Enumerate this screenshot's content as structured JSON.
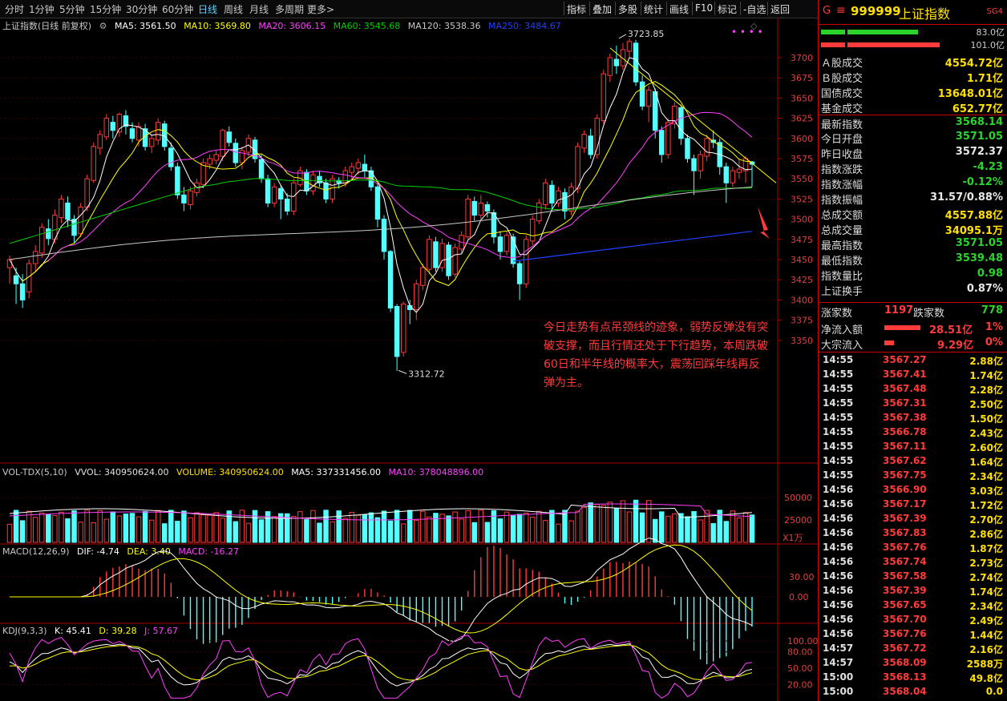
{
  "toolbar": {
    "periods": [
      "分时",
      "1分钟",
      "5分钟",
      "15分钟",
      "30分钟",
      "60分钟",
      "日线",
      "周线",
      "月线",
      "多周期",
      "更多>"
    ],
    "active_period": "日线",
    "buttons": [
      "指标",
      "叠加",
      "多股",
      "统计",
      "画线",
      "F10",
      "标记",
      "-自选",
      "返回"
    ]
  },
  "main_legend": {
    "title": "上证指数(日线 前复权)",
    "ma5": "MA5: 3561.50",
    "ma10": "MA10: 3569.80",
    "ma20": "MA20: 3606.15",
    "ma60": "MA60: 3545.68",
    "ma120": "MA120: 3538.36",
    "ma250": "MA250: 3484.67"
  },
  "high_label": "3723.85",
  "low_label": "3312.72",
  "price_axis": [
    "3700",
    "3675",
    "3650",
    "3625",
    "3600",
    "3575",
    "3550",
    "3525",
    "3500",
    "3475",
    "3450",
    "3425",
    "3400",
    "3375",
    "3350"
  ],
  "vol_legend": {
    "title": "VOL-TDX(5,10)",
    "vvol": "VVOL: 340950624.00",
    "volume": "VOLUME: 340950624.00",
    "ma5": "MA5: 337331456.00",
    "ma10": "MA10: 378048896.00"
  },
  "vol_axis": [
    "50000",
    "25000"
  ],
  "vol_unit": "X1万",
  "macd_legend": {
    "title": "MACD(12,26,9)",
    "dif": "DIF: -4.74",
    "dea": "DEA: 3.40",
    "macd": "MACD: -16.27"
  },
  "macd_axis": [
    "30.00",
    "0.00"
  ],
  "kdj_legend": {
    "title": "KDJ(9,3,3)",
    "k": "K: 45.41",
    "d": "D: 39.28",
    "j": "J: 57.67"
  },
  "kdj_axis": [
    "100.00",
    "80.00",
    "50.00",
    "20.00"
  ],
  "annotation": "今日走势有点吊颈线的迹象，弱势反弹没有突破支撑，而且行情还处于下行趋势，本周跌破60日和半年线的概率大，震荡回踩年线再反弹为主。",
  "quote": {
    "g": "G",
    "menu_icon": "≡",
    "code": "999999",
    "name": "上证指数",
    "badge": "SG4",
    "bar1": "83.0亿",
    "bar2": "101.0亿",
    "rows": [
      {
        "k": "Ａ股成交",
        "v": "4554.72亿",
        "c": "#ffe000"
      },
      {
        "k": "Ｂ股成交",
        "v": "1.71亿",
        "c": "#ffe000"
      },
      {
        "k": "国债成交",
        "v": "13648.01亿",
        "c": "#ffe000"
      },
      {
        "k": "基金成交",
        "v": "652.77亿",
        "c": "#ffe000"
      },
      {
        "k": "最新指数",
        "v": "3568.14",
        "c": "#2bd42b"
      },
      {
        "k": "今日开盘",
        "v": "3571.05",
        "c": "#2bd42b"
      },
      {
        "k": "昨日收盘",
        "v": "3572.37",
        "c": "#e8e8e8"
      },
      {
        "k": "指数涨跌",
        "v": "-4.23",
        "c": "#2bd42b"
      },
      {
        "k": "指数涨幅",
        "v": "-0.12%",
        "c": "#2bd42b"
      },
      {
        "k": "指数振幅",
        "v": "31.57/0.88%",
        "c": "#e8e8e8"
      },
      {
        "k": "总成交额",
        "v": "4557.88亿",
        "c": "#ffe000"
      },
      {
        "k": "总成交量",
        "v": "34095.1万",
        "c": "#ffe000"
      },
      {
        "k": "最高指数",
        "v": "3571.05",
        "c": "#2bd42b"
      },
      {
        "k": "最低指数",
        "v": "3539.48",
        "c": "#2bd42b"
      },
      {
        "k": "指数量比",
        "v": "0.98",
        "c": "#2bd42b"
      },
      {
        "k": "上证换手",
        "v": "0.87%",
        "c": "#e8e8e8"
      }
    ],
    "up_label": "涨家数",
    "up_value": "1197",
    "down_label": "跌家数",
    "down_value": "778",
    "net_label": "净流入额",
    "net_value": "28.51亿",
    "net_pct": "1%",
    "block_label": "大宗流入",
    "block_value": "9.29亿",
    "block_pct": "0%"
  },
  "ticks": [
    {
      "t": "14:55",
      "p": "3567.27",
      "a": "2.88亿"
    },
    {
      "t": "14:55",
      "p": "3567.41",
      "a": "1.74亿"
    },
    {
      "t": "14:55",
      "p": "3567.48",
      "a": "2.28亿"
    },
    {
      "t": "14:55",
      "p": "3567.31",
      "a": "2.50亿"
    },
    {
      "t": "14:55",
      "p": "3567.38",
      "a": "1.50亿"
    },
    {
      "t": "14:55",
      "p": "3566.78",
      "a": "2.43亿"
    },
    {
      "t": "14:55",
      "p": "3567.11",
      "a": "2.60亿"
    },
    {
      "t": "14:55",
      "p": "3567.62",
      "a": "1.64亿"
    },
    {
      "t": "14:55",
      "p": "3567.75",
      "a": "2.34亿"
    },
    {
      "t": "14:56",
      "p": "3566.90",
      "a": "3.03亿"
    },
    {
      "t": "14:56",
      "p": "3567.17",
      "a": "1.72亿"
    },
    {
      "t": "14:56",
      "p": "3567.39",
      "a": "2.70亿"
    },
    {
      "t": "14:56",
      "p": "3567.83",
      "a": "2.86亿"
    },
    {
      "t": "14:56",
      "p": "3567.76",
      "a": "1.87亿"
    },
    {
      "t": "14:56",
      "p": "3567.74",
      "a": "2.73亿"
    },
    {
      "t": "14:56",
      "p": "3567.58",
      "a": "2.74亿"
    },
    {
      "t": "14:56",
      "p": "3567.39",
      "a": "1.74亿"
    },
    {
      "t": "14:56",
      "p": "3567.65",
      "a": "2.34亿"
    },
    {
      "t": "14:56",
      "p": "3567.70",
      "a": "2.49亿"
    },
    {
      "t": "14:56",
      "p": "3567.76",
      "a": "1.44亿"
    },
    {
      "t": "14:57",
      "p": "3567.72",
      "a": "2.16亿"
    },
    {
      "t": "14:57",
      "p": "3568.09",
      "a": "2588万"
    },
    {
      "t": "15:00",
      "p": "3568.13",
      "a": "49.8亿"
    },
    {
      "t": "15:00",
      "p": "3568.04",
      "a": "0.0"
    }
  ],
  "colors": {
    "up": "#ff3b3b",
    "down": "#54ffff",
    "ma5": "#ffffff",
    "ma10": "#ffff00",
    "ma20": "#ff40ff",
    "ma60": "#00d000",
    "ma120": "#c8c8c8",
    "ma250": "#2040ff"
  },
  "chart_data": {
    "type": "candlestick",
    "note": "approximate daily candles read from gridlines",
    "candles": [
      [
        3440,
        3450,
        3420,
        3455
      ],
      [
        3430,
        3420,
        3395,
        3440
      ],
      [
        3420,
        3400,
        3390,
        3432
      ],
      [
        3410,
        3445,
        3402,
        3450
      ],
      [
        3445,
        3460,
        3435,
        3468
      ],
      [
        3458,
        3490,
        3452,
        3495
      ],
      [
        3488,
        3476,
        3468,
        3500
      ],
      [
        3475,
        3505,
        3470,
        3512
      ],
      [
        3502,
        3525,
        3495,
        3530
      ],
      [
        3520,
        3500,
        3490,
        3528
      ],
      [
        3500,
        3480,
        3470,
        3505
      ],
      [
        3482,
        3515,
        3478,
        3520
      ],
      [
        3515,
        3550,
        3510,
        3555
      ],
      [
        3548,
        3590,
        3545,
        3595
      ],
      [
        3588,
        3605,
        3580,
        3610
      ],
      [
        3602,
        3625,
        3598,
        3630
      ],
      [
        3620,
        3610,
        3600,
        3628
      ],
      [
        3608,
        3630,
        3602,
        3632
      ],
      [
        3628,
        3615,
        3605,
        3635
      ],
      [
        3612,
        3600,
        3595,
        3620
      ],
      [
        3598,
        3615,
        3590,
        3620
      ],
      [
        3612,
        3590,
        3585,
        3618
      ],
      [
        3590,
        3600,
        3582,
        3605
      ],
      [
        3598,
        3620,
        3592,
        3625
      ],
      [
        3618,
        3590,
        3585,
        3622
      ],
      [
        3588,
        3565,
        3560,
        3595
      ],
      [
        3565,
        3530,
        3525,
        3570
      ],
      [
        3530,
        3520,
        3510,
        3540
      ],
      [
        3518,
        3535,
        3512,
        3540
      ],
      [
        3533,
        3545,
        3528,
        3550
      ],
      [
        3543,
        3570,
        3538,
        3575
      ],
      [
        3568,
        3575,
        3562,
        3580
      ],
      [
        3573,
        3580,
        3568,
        3585
      ],
      [
        3578,
        3610,
        3572,
        3612
      ],
      [
        3608,
        3595,
        3590,
        3615
      ],
      [
        3594,
        3570,
        3565,
        3600
      ],
      [
        3570,
        3585,
        3562,
        3590
      ],
      [
        3583,
        3600,
        3578,
        3605
      ],
      [
        3598,
        3575,
        3570,
        3602
      ],
      [
        3574,
        3550,
        3545,
        3580
      ],
      [
        3550,
        3520,
        3515,
        3555
      ],
      [
        3520,
        3540,
        3515,
        3545
      ],
      [
        3538,
        3525,
        3500,
        3542
      ],
      [
        3525,
        3510,
        3505,
        3532
      ],
      [
        3510,
        3545,
        3505,
        3550
      ],
      [
        3543,
        3560,
        3540,
        3565
      ],
      [
        3558,
        3535,
        3530,
        3562
      ],
      [
        3535,
        3555,
        3530,
        3560
      ],
      [
        3553,
        3545,
        3540,
        3560
      ],
      [
        3545,
        3525,
        3520,
        3550
      ],
      [
        3525,
        3550,
        3520,
        3555
      ],
      [
        3548,
        3545,
        3538,
        3552
      ],
      [
        3545,
        3560,
        3540,
        3565
      ],
      [
        3558,
        3565,
        3550,
        3570
      ],
      [
        3563,
        3570,
        3555,
        3575
      ],
      [
        3568,
        3560,
        3552,
        3580
      ],
      [
        3560,
        3540,
        3535,
        3565
      ],
      [
        3540,
        3500,
        3490,
        3545
      ],
      [
        3500,
        3460,
        3450,
        3505
      ],
      [
        3460,
        3390,
        3385,
        3462
      ],
      [
        3392,
        3330,
        3312,
        3395
      ],
      [
        3335,
        3395,
        3330,
        3398
      ],
      [
        3393,
        3388,
        3370,
        3400
      ],
      [
        3388,
        3420,
        3375,
        3425
      ],
      [
        3418,
        3440,
        3412,
        3445
      ],
      [
        3438,
        3475,
        3432,
        3480
      ],
      [
        3472,
        3440,
        3435,
        3478
      ],
      [
        3440,
        3470,
        3435,
        3476
      ],
      [
        3468,
        3430,
        3425,
        3472
      ],
      [
        3432,
        3465,
        3428,
        3470
      ],
      [
        3463,
        3480,
        3458,
        3485
      ],
      [
        3478,
        3525,
        3475,
        3530
      ],
      [
        3522,
        3505,
        3498,
        3528
      ],
      [
        3505,
        3520,
        3500,
        3530
      ],
      [
        3518,
        3510,
        3502,
        3522
      ],
      [
        3508,
        3478,
        3470,
        3512
      ],
      [
        3478,
        3460,
        3450,
        3485
      ],
      [
        3460,
        3480,
        3455,
        3485
      ],
      [
        3478,
        3445,
        3440,
        3482
      ],
      [
        3445,
        3420,
        3400,
        3448
      ],
      [
        3420,
        3475,
        3415,
        3480
      ],
      [
        3473,
        3500,
        3468,
        3505
      ],
      [
        3498,
        3520,
        3494,
        3525
      ],
      [
        3518,
        3545,
        3512,
        3550
      ],
      [
        3542,
        3520,
        3510,
        3548
      ],
      [
        3520,
        3535,
        3515,
        3540
      ],
      [
        3533,
        3510,
        3500,
        3538
      ],
      [
        3510,
        3540,
        3505,
        3545
      ],
      [
        3538,
        3590,
        3532,
        3595
      ],
      [
        3588,
        3605,
        3582,
        3610
      ],
      [
        3603,
        3580,
        3575,
        3612
      ],
      [
        3580,
        3625,
        3575,
        3630
      ],
      [
        3622,
        3680,
        3618,
        3685
      ],
      [
        3678,
        3700,
        3670,
        3705
      ],
      [
        3698,
        3690,
        3680,
        3715
      ],
      [
        3690,
        3710,
        3685,
        3718
      ],
      [
        3708,
        3720,
        3700,
        3724
      ],
      [
        3718,
        3670,
        3665,
        3722
      ],
      [
        3670,
        3640,
        3635,
        3678
      ],
      [
        3640,
        3660,
        3620,
        3665
      ],
      [
        3658,
        3610,
        3600,
        3662
      ],
      [
        3610,
        3580,
        3570,
        3615
      ],
      [
        3580,
        3620,
        3575,
        3625
      ],
      [
        3618,
        3640,
        3612,
        3645
      ],
      [
        3638,
        3600,
        3592,
        3642
      ],
      [
        3600,
        3575,
        3570,
        3605
      ],
      [
        3575,
        3560,
        3530,
        3580
      ],
      [
        3560,
        3580,
        3550,
        3585
      ],
      [
        3578,
        3600,
        3572,
        3605
      ],
      [
        3598,
        3595,
        3588,
        3610
      ],
      [
        3595,
        3565,
        3555,
        3600
      ],
      [
        3565,
        3545,
        3520,
        3570
      ],
      [
        3545,
        3560,
        3540,
        3565
      ],
      [
        3558,
        3562,
        3550,
        3575
      ],
      [
        3560,
        3575,
        3545,
        3578
      ],
      [
        3571,
        3568,
        3540,
        3572
      ]
    ]
  }
}
